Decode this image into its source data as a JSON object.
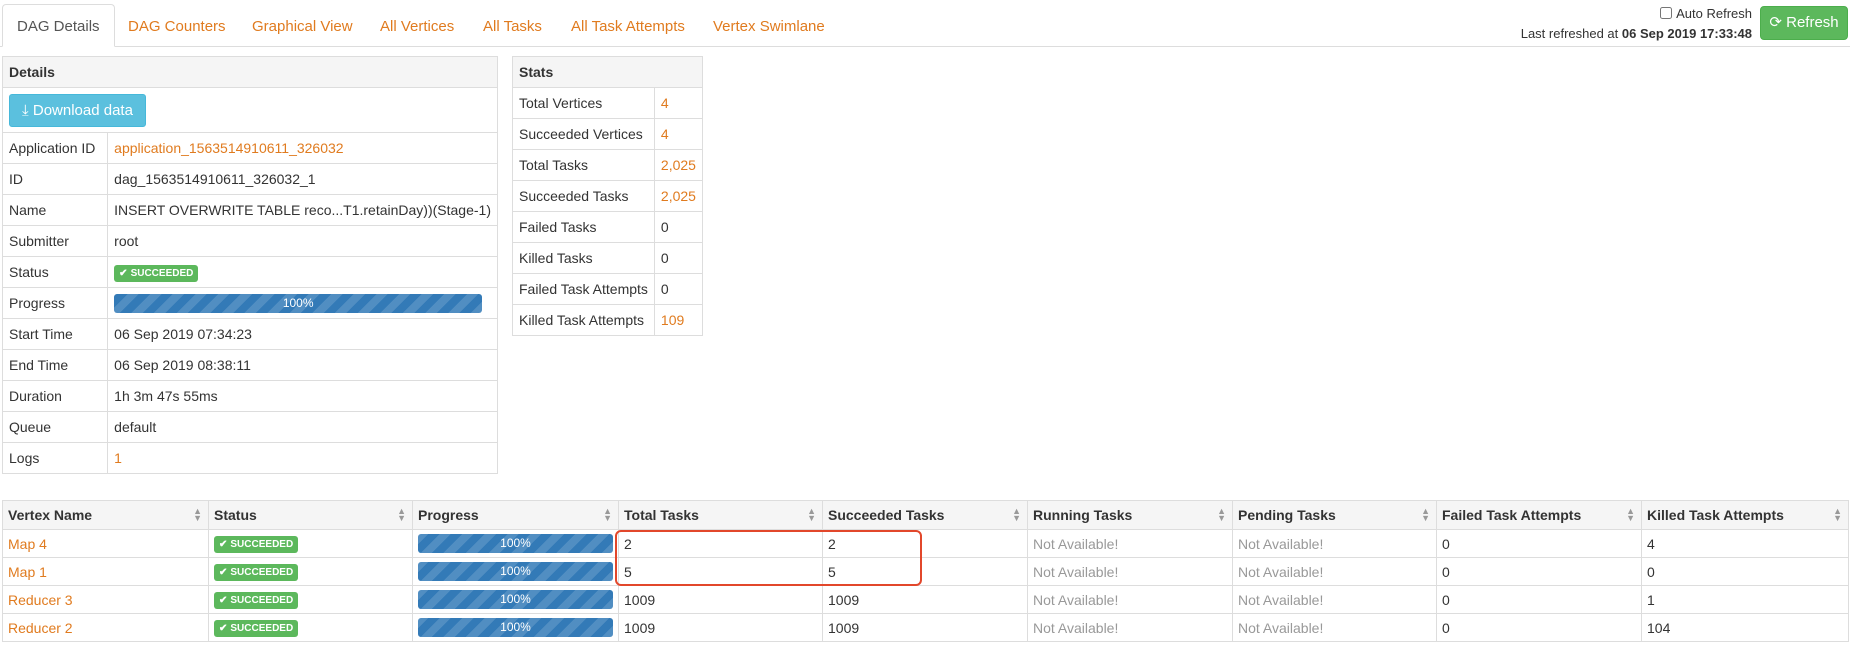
{
  "tabs": [
    "DAG Details",
    "DAG Counters",
    "Graphical View",
    "All Vertices",
    "All Tasks",
    "All Task Attempts",
    "Vertex Swimlane"
  ],
  "header": {
    "auto_refresh_label": "Auto Refresh",
    "last_refreshed_prefix": "Last refreshed at ",
    "last_refreshed_time": "06 Sep 2019 17:33:48",
    "refresh_label": "Refresh"
  },
  "details": {
    "title": "Details",
    "download_label": "Download data",
    "app_id_label": "Application ID",
    "app_id": "application_1563514910611_326032",
    "id_label": "ID",
    "id": "dag_1563514910611_326032_1",
    "name_label": "Name",
    "name": "INSERT OVERWRITE TABLE reco...T1.retainDay))(Stage-1)",
    "submitter_label": "Submitter",
    "submitter": "root",
    "status_label": "Status",
    "status": "SUCCEEDED",
    "progress_label": "Progress",
    "progress": "100%",
    "start_label": "Start Time",
    "start": "06 Sep 2019 07:34:23",
    "end_label": "End Time",
    "end": "06 Sep 2019 08:38:11",
    "duration_label": "Duration",
    "duration": "1h 3m 47s 55ms",
    "queue_label": "Queue",
    "queue": "default",
    "logs_label": "Logs",
    "logs": "1"
  },
  "stats": {
    "title": "Stats",
    "rows": [
      {
        "label": "Total Vertices",
        "value": "4",
        "link": true
      },
      {
        "label": "Succeeded Vertices",
        "value": "4",
        "link": true
      },
      {
        "label": "Total Tasks",
        "value": "2,025",
        "link": true
      },
      {
        "label": "Succeeded Tasks",
        "value": "2,025",
        "link": true
      },
      {
        "label": "Failed Tasks",
        "value": "0",
        "link": false
      },
      {
        "label": "Killed Tasks",
        "value": "0",
        "link": false
      },
      {
        "label": "Failed Task Attempts",
        "value": "0",
        "link": false
      },
      {
        "label": "Killed Task Attempts",
        "value": "109",
        "link": true
      }
    ]
  },
  "vertices": {
    "columns": [
      "Vertex Name",
      "Status",
      "Progress",
      "Total Tasks",
      "Succeeded Tasks",
      "Running Tasks",
      "Pending Tasks",
      "Failed Task Attempts",
      "Killed Task Attempts"
    ],
    "rows": [
      {
        "name": "Map 4",
        "status": "SUCCEEDED",
        "progress": "100%",
        "total": "2",
        "succeeded": "2",
        "running": "Not Available!",
        "pending": "Not Available!",
        "failed": "0",
        "killed": "4"
      },
      {
        "name": "Map 1",
        "status": "SUCCEEDED",
        "progress": "100%",
        "total": "5",
        "succeeded": "5",
        "running": "Not Available!",
        "pending": "Not Available!",
        "failed": "0",
        "killed": "0"
      },
      {
        "name": "Reducer 3",
        "status": "SUCCEEDED",
        "progress": "100%",
        "total": "1009",
        "succeeded": "1009",
        "running": "Not Available!",
        "pending": "Not Available!",
        "failed": "0",
        "killed": "1"
      },
      {
        "name": "Reducer 2",
        "status": "SUCCEEDED",
        "progress": "100%",
        "total": "1009",
        "succeeded": "1009",
        "running": "Not Available!",
        "pending": "Not Available!",
        "failed": "0",
        "killed": "104"
      }
    ]
  },
  "colors": {
    "accent": "#e07b1f",
    "success": "#5cb85c",
    "info": "#5bc0de",
    "progress": "#337ab7",
    "highlight": "#e2472b"
  }
}
